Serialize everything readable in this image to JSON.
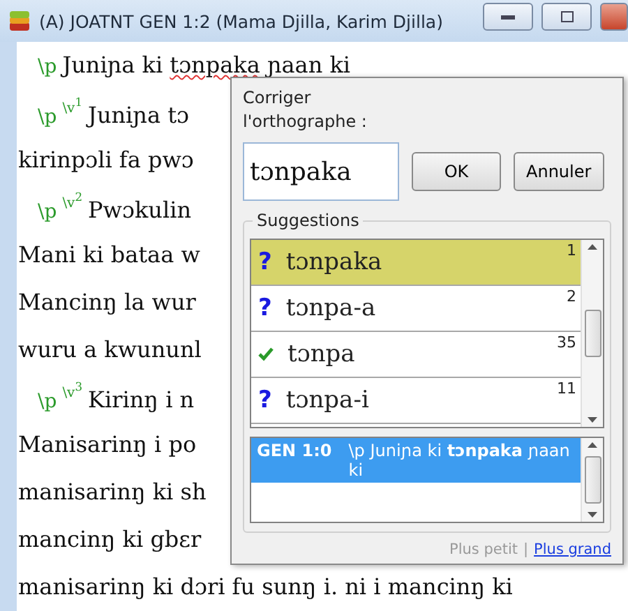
{
  "window": {
    "title": "(A) JOATNT GEN 1:2 (Mama Djilla, Karim Djilla)"
  },
  "editor": {
    "lines": [
      {
        "marker": "\\p",
        "text": "Juniɲa ki ",
        "misspelled": "tɔnpaka",
        "after": " ɲaan ki"
      },
      {
        "marker": "\\p",
        "verse": "\\v",
        "verse_number": "1",
        "text": "Juniɲa tɔ"
      },
      {
        "text": "kirinpɔli fa pwɔ"
      },
      {
        "marker": "\\p",
        "verse": "\\v",
        "verse_number": "2",
        "text": "Pwɔkulin"
      },
      {
        "text": "Mani ki bataa w"
      },
      {
        "text": "Mancinŋ la wur"
      },
      {
        "text": "wuru a kwununl"
      },
      {
        "marker": "\\p",
        "verse": "\\v",
        "verse_number": "3",
        "text": "Kirinŋ i n"
      },
      {
        "text": "Manisarinŋ i po"
      },
      {
        "text": "manisarinŋ ki sh"
      },
      {
        "text": "mancinŋ ki gbɛr"
      },
      {
        "text": "manisarinŋ ki dɔri fu sunŋ i. ni i mancinŋ ki"
      }
    ]
  },
  "dialog": {
    "label": "Corriger l'orthographe :",
    "input": "tɔnpaka",
    "ok": "OK",
    "cancel": "Annuler",
    "suggestions_title": "Suggestions",
    "suggestions": [
      {
        "kind": "question",
        "icon": "?",
        "word": "tɔnpaka",
        "count": "1",
        "selected": true
      },
      {
        "kind": "question",
        "icon": "?",
        "word": "tɔnpa-a",
        "count": "2",
        "selected": false
      },
      {
        "kind": "check",
        "word": "tɔnpa",
        "count": "35",
        "selected": false
      },
      {
        "kind": "question",
        "icon": "?",
        "word": "tɔnpa-i",
        "count": "11",
        "selected": false
      }
    ],
    "context": [
      {
        "ref": "GEN 1:0",
        "text": "\\p Juniɲa ki **tɔnpaka** ɲaan ki",
        "selected": true
      }
    ],
    "smaller": "Plus petit",
    "separator": "|",
    "larger": "Plus grand"
  }
}
